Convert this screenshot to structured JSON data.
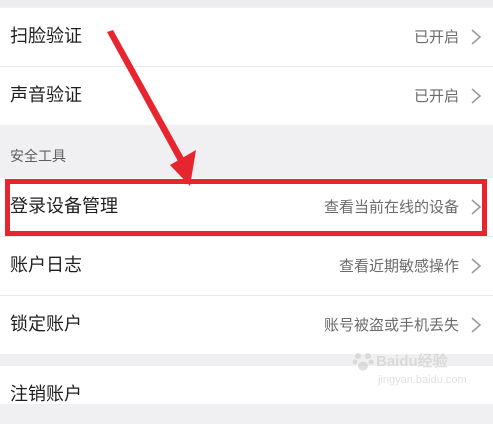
{
  "security_rows": [
    {
      "label": "扫脸验证",
      "value": "已开启"
    },
    {
      "label": "声音验证",
      "value": "已开启"
    }
  ],
  "section": {
    "title": "安全工具"
  },
  "tools_rows": [
    {
      "label": "登录设备管理",
      "value": "查看当前在线的设备"
    },
    {
      "label": "账户日志",
      "value": "查看近期敏感操作"
    },
    {
      "label": "锁定账户",
      "value": "账号被盗或手机丢失"
    }
  ],
  "bottom_rows": [
    {
      "label": "注销账户"
    }
  ],
  "annotation": {
    "highlight_color": "#e8242e"
  },
  "watermark": {
    "text": "Baidu经验",
    "sub": "jingyan.baidu.com"
  },
  "icons": {
    "chevron": "chevron-right-icon"
  }
}
